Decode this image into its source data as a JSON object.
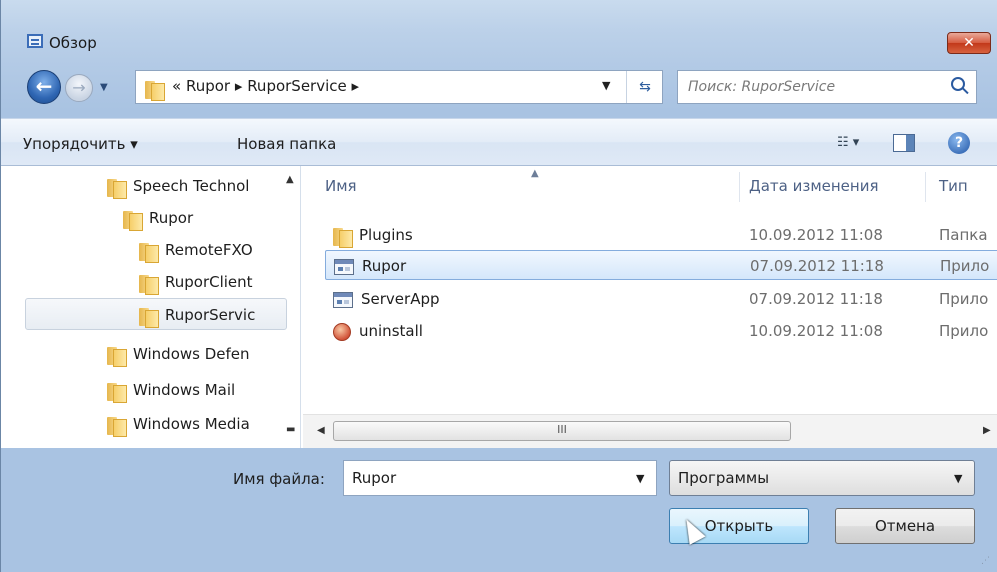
{
  "window": {
    "title": "Обзор",
    "close_label": "✕"
  },
  "nav": {
    "path_prefix": "«",
    "breadcrumbs": [
      "Rupor",
      "RuporService"
    ],
    "search_placeholder": "Поиск: RuporService"
  },
  "toolbar": {
    "organize_label": "Упорядочить",
    "new_folder_label": "Новая папка"
  },
  "tree": {
    "items": [
      {
        "label": "Speech Technol"
      },
      {
        "label": "Rupor"
      },
      {
        "label": "RemoteFXO"
      },
      {
        "label": "RuporClient"
      },
      {
        "label": "RuporServic"
      },
      {
        "label": "Windows Defen"
      },
      {
        "label": "Windows Mail"
      },
      {
        "label": "Windows Media"
      }
    ],
    "selected": "RuporServic"
  },
  "filelist": {
    "columns": [
      "Имя",
      "Дата изменения",
      "Тип"
    ],
    "rows": [
      {
        "name": "Plugins",
        "date": "10.09.2012 11:08",
        "type": "Папка",
        "icon": "folder-icon"
      },
      {
        "name": "Rupor",
        "date": "07.09.2012 11:18",
        "type": "Прило",
        "icon": "application-icon"
      },
      {
        "name": "ServerApp",
        "date": "07.09.2012 11:18",
        "type": "Прило",
        "icon": "application-icon"
      },
      {
        "name": "uninstall",
        "date": "10.09.2012 11:08",
        "type": "Прило",
        "icon": "uninstall-icon"
      }
    ],
    "selected": "Rupor",
    "scroll_thumb_grip": "III"
  },
  "bottom": {
    "filename_label": "Имя файла:",
    "filename_value": "Rupor",
    "filter_value": "Программы",
    "open_label": "Открыть",
    "cancel_label": "Отмена"
  },
  "colors": {
    "chrome": "#bcd1e9",
    "selection": "#d5e7fb",
    "close": "#c2381a"
  }
}
